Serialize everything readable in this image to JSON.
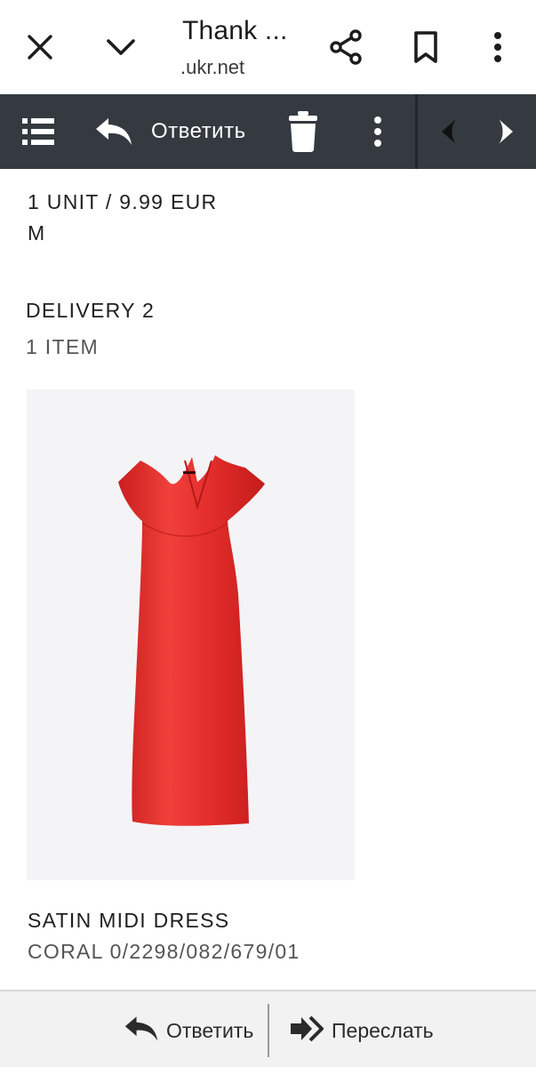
{
  "browser": {
    "title": "Thank ...",
    "domain": ".ukr.net",
    "icons": [
      "close-icon",
      "chevron-down-icon",
      "share-icon",
      "bookmark-icon",
      "more-vertical-icon"
    ]
  },
  "toolbar": {
    "reply_label": "Ответить",
    "icons": [
      "list-menu-icon",
      "reply-icon",
      "trash-icon",
      "more-vertical-icon",
      "previous-icon",
      "next-icon"
    ]
  },
  "order": {
    "unit_price": "1 UNIT / 9.99 EUR",
    "size": "M",
    "delivery_heading": "DELIVERY 2",
    "item_count": "1 ITEM",
    "product_name": "SATIN MIDI DRESS",
    "product_details": "CORAL 0/2298/082/679/01",
    "product_color": "#e8312f"
  },
  "bottom_bar": {
    "reply_label": "Ответить",
    "forward_label": "Переслать",
    "icons": [
      "reply-icon",
      "forward-icon"
    ]
  }
}
